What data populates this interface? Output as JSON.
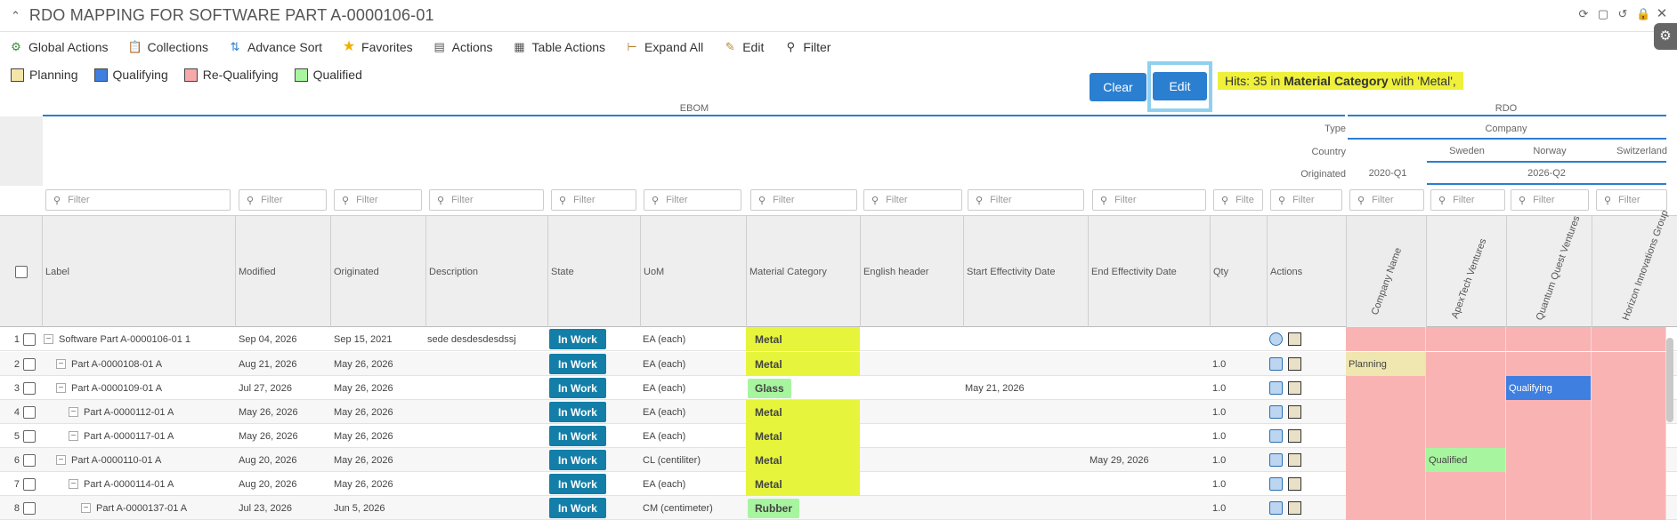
{
  "window": {
    "title": "RDO MAPPING FOR SOFTWARE PART A-0000106-01"
  },
  "toolbar": {
    "global_actions": "Global Actions",
    "collections": "Collections",
    "advance_sort": "Advance Sort",
    "favorites": "Favorites",
    "actions": "Actions",
    "table_actions": "Table Actions",
    "expand_all": "Expand All",
    "edit": "Edit",
    "filter": "Filter"
  },
  "legend": [
    {
      "label": "Planning",
      "color": "#f5e6a8"
    },
    {
      "label": "Qualifying",
      "color": "#3f7fe0"
    },
    {
      "label": "Re-Qualifying",
      "color": "#f6a9a9"
    },
    {
      "label": "Qualified",
      "color": "#a8f5a0"
    }
  ],
  "buttons": {
    "clear": "Clear",
    "edit": "Edit"
  },
  "hits": {
    "prefix": "Hits: 35 in ",
    "field": "Material Category",
    "suffix": " with 'Metal',"
  },
  "groups": {
    "ebom": "EBOM",
    "rdo": "RDO",
    "type_label": "Type",
    "type_value": "Company",
    "country_label": "Country",
    "countries": [
      "Sweden",
      "Norway",
      "Switzerland"
    ],
    "originated_label": "Originated",
    "originated": [
      "2020-Q1",
      "2026-Q2"
    ]
  },
  "filter_placeholder": "Filter",
  "filter_short": "Filte",
  "columns": [
    "Label",
    "Modified",
    "Originated",
    "Description",
    "State",
    "UoM",
    "Material Category",
    "English header",
    "Start Effectivity Date",
    "End Effectivity Date",
    "Qty",
    "Actions"
  ],
  "rdo_columns": [
    "Company Name",
    "ApexTech Ventures",
    "Quantum Quest Ventures",
    "Horizon Innovations Group"
  ],
  "colors": {
    "state": "#137fa8",
    "metal": "#e6f53c",
    "glass": "#a8f5a0",
    "rdo_red": "#f9b3b3",
    "planning": "#f0e6b0",
    "qualifying": "#3f7fe0",
    "qualified": "#a8f5a0"
  },
  "rows": [
    {
      "num": "1",
      "label": "Software Part A-0000106-01 1",
      "modified": "Sep 04, 2026",
      "originated": "Sep 15, 2021",
      "description": "sede desdesdesdssj",
      "state": "In Work",
      "uom": "EA (each)",
      "material": "Metal",
      "start": "",
      "end": "",
      "qty": "",
      "rdo": [
        "",
        "",
        "",
        ""
      ]
    },
    {
      "num": "2",
      "label": "Part A-0000108-01 A",
      "modified": "Aug 21, 2026",
      "originated": "May 26, 2026",
      "description": "",
      "state": "In Work",
      "uom": "EA (each)",
      "material": "Metal",
      "start": "",
      "end": "",
      "qty": "1.0",
      "rdo": [
        "Planning",
        "",
        "",
        ""
      ]
    },
    {
      "num": "3",
      "label": "Part A-0000109-01 A",
      "modified": "Jul 27, 2026",
      "originated": "May 26, 2026",
      "description": "",
      "state": "In Work",
      "uom": "EA (each)",
      "material": "Glass",
      "start": "May 21, 2026",
      "end": "",
      "qty": "1.0",
      "rdo": [
        "",
        "",
        "Qualifying",
        ""
      ]
    },
    {
      "num": "4",
      "label": "Part A-0000112-01 A",
      "modified": "May 26, 2026",
      "originated": "May 26, 2026",
      "description": "",
      "state": "In Work",
      "uom": "EA (each)",
      "material": "Metal",
      "start": "",
      "end": "",
      "qty": "1.0",
      "rdo": [
        "",
        "",
        "",
        ""
      ]
    },
    {
      "num": "5",
      "label": "Part A-0000117-01 A",
      "modified": "May 26, 2026",
      "originated": "May 26, 2026",
      "description": "",
      "state": "In Work",
      "uom": "EA (each)",
      "material": "Metal",
      "start": "",
      "end": "",
      "qty": "1.0",
      "rdo": [
        "",
        "",
        "",
        ""
      ]
    },
    {
      "num": "6",
      "label": "Part A-0000110-01 A",
      "modified": "Aug 20, 2026",
      "originated": "May 26, 2026",
      "description": "",
      "state": "In Work",
      "uom": "CL (centiliter)",
      "material": "Metal",
      "start": "",
      "end": "May 29, 2026",
      "qty": "1.0",
      "rdo": [
        "",
        "Qualified",
        "",
        ""
      ]
    },
    {
      "num": "7",
      "label": "Part A-0000114-01 A",
      "modified": "Aug 20, 2026",
      "originated": "May 26, 2026",
      "description": "",
      "state": "In Work",
      "uom": "EA (each)",
      "material": "Metal",
      "start": "",
      "end": "",
      "qty": "1.0",
      "rdo": [
        "",
        "",
        "",
        ""
      ]
    },
    {
      "num": "8",
      "label": "Part A-0000137-01 A",
      "modified": "Jul 23, 2026",
      "originated": "Jun 5, 2026",
      "description": "",
      "state": "In Work",
      "uom": "CM (centimeter)",
      "material": "Rubber",
      "start": "",
      "end": "",
      "qty": "1.0",
      "rdo": [
        "",
        "",
        "",
        ""
      ]
    }
  ]
}
